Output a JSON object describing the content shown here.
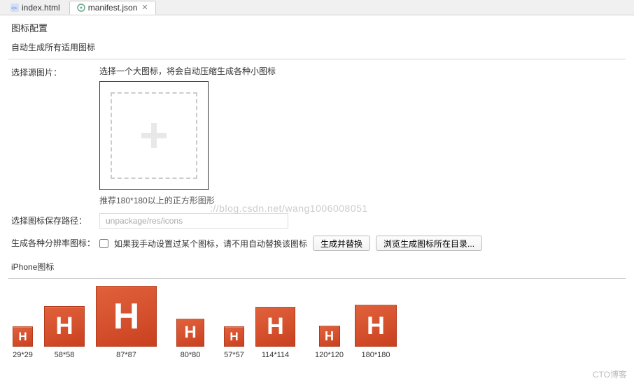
{
  "tabs": {
    "items": [
      {
        "label": "index.html",
        "active": false
      },
      {
        "label": "manifest.json",
        "active": true
      }
    ]
  },
  "panel": {
    "title": "图标配置"
  },
  "auto_gen": {
    "legend": "自动生成所有适用图标",
    "source_label": "选择源图片：",
    "source_hint": "选择一个大图标，将会自动压缩生成各种小图标",
    "dropzone_caption": "推荐180*180以上的正方形图形",
    "save_path_label": "选择图标保存路径：",
    "save_path_value": "unpackage/res/icons",
    "gen_label": "生成各种分辨率图标：",
    "checkbox_hint": "如果我手动设置过某个图标，请不用自动替换该图标",
    "btn_generate": "生成并替换",
    "btn_browse": "浏览生成图标所在目录..."
  },
  "iphone": {
    "legend": "iPhone图标",
    "clusters": [
      {
        "icons": [
          {
            "size": 29,
            "label": "29*29"
          },
          {
            "size": 58,
            "label": "58*58"
          },
          {
            "size": 87,
            "label": "87*87"
          }
        ]
      },
      {
        "icons": [
          {
            "size": 40,
            "label": "80*80"
          }
        ]
      },
      {
        "icons": [
          {
            "size": 29,
            "label": "57*57"
          },
          {
            "size": 57,
            "label": "114*114"
          }
        ]
      },
      {
        "icons": [
          {
            "size": 30,
            "label": "120*120"
          },
          {
            "size": 60,
            "label": "180*180"
          }
        ]
      }
    ]
  },
  "watermark": {
    "url": "://blog.csdn.net/wang1006008051",
    "brand": "CTO博客"
  }
}
